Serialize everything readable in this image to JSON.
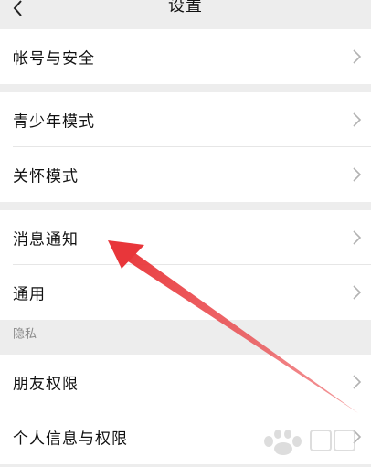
{
  "header": {
    "title": "设置",
    "back_icon": "chevron-left-icon"
  },
  "groups": [
    {
      "items": [
        {
          "label": "帐号与安全"
        }
      ]
    },
    {
      "items": [
        {
          "label": "青少年模式"
        },
        {
          "label": "关怀模式"
        }
      ]
    },
    {
      "items": [
        {
          "label": "消息通知"
        },
        {
          "label": "通用"
        }
      ]
    },
    {
      "header": "隐私",
      "items": [
        {
          "label": "朋友权限"
        },
        {
          "label": "个人信息与权限"
        }
      ]
    }
  ],
  "row_chevron_icon": "chevron-right-icon",
  "annotation": {
    "arrow_color": "#e8363a",
    "arrow_target": "消息通知"
  },
  "colors": {
    "background": "#ededed",
    "row_background": "#ffffff",
    "text": "#111111",
    "secondary_text": "#8a8a8a",
    "chevron": "#b2b2b2"
  }
}
